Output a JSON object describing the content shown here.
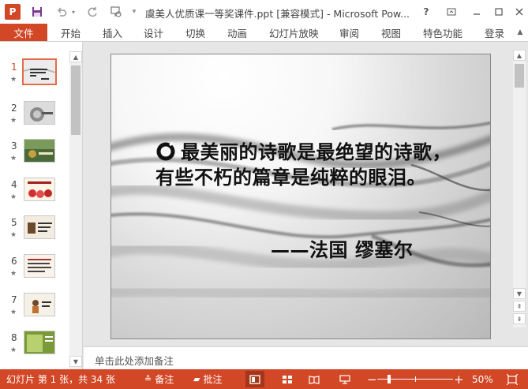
{
  "titlebar": {
    "app_logo": "P",
    "doc_title": "虞美人优质课一等奖课件.ppt [兼容模式] - Microsoft Pow...",
    "help": "?",
    "icons": [
      "powerpoint-logo-icon",
      "save-icon",
      "undo-icon",
      "redo-icon",
      "start-presentation-icon",
      "customize-toolbar-icon",
      "help-icon",
      "ribbon-display-options-icon",
      "minimize-icon",
      "maximize-icon",
      "close-icon"
    ]
  },
  "ribbon": {
    "file_tab": "文件",
    "tabs": [
      "开始",
      "插入",
      "设计",
      "切换",
      "动画",
      "幻灯片放映",
      "审阅",
      "视图",
      "特色功能"
    ],
    "login": "登录"
  },
  "thumbnails": {
    "selected": 1,
    "items": [
      {
        "number": "1",
        "star": "★"
      },
      {
        "number": "2",
        "star": "★"
      },
      {
        "number": "3",
        "star": "★"
      },
      {
        "number": "4",
        "star": "★"
      },
      {
        "number": "5",
        "star": "★"
      },
      {
        "number": "6",
        "star": "★"
      },
      {
        "number": "7",
        "star": "★"
      },
      {
        "number": "8",
        "star": "★"
      }
    ]
  },
  "slide": {
    "quote": "最美丽的诗歌是最绝望的诗歌，有些不朽的篇章是纯粹的眼泪。",
    "attribution": "——法国 缪塞尔"
  },
  "notes": {
    "placeholder": "单击此处添加备注"
  },
  "statusbar": {
    "slide_count": "幻灯片 第 1 张，共 34 张",
    "notes_label": "备注",
    "comments_label": "批注",
    "zoom_out": "−",
    "zoom_in": "+",
    "zoom_level": "50%",
    "zoom_percent": 50
  },
  "colors": {
    "accent": "#d24726",
    "status_bar": "#d24726",
    "active_view": "#a5361b"
  }
}
